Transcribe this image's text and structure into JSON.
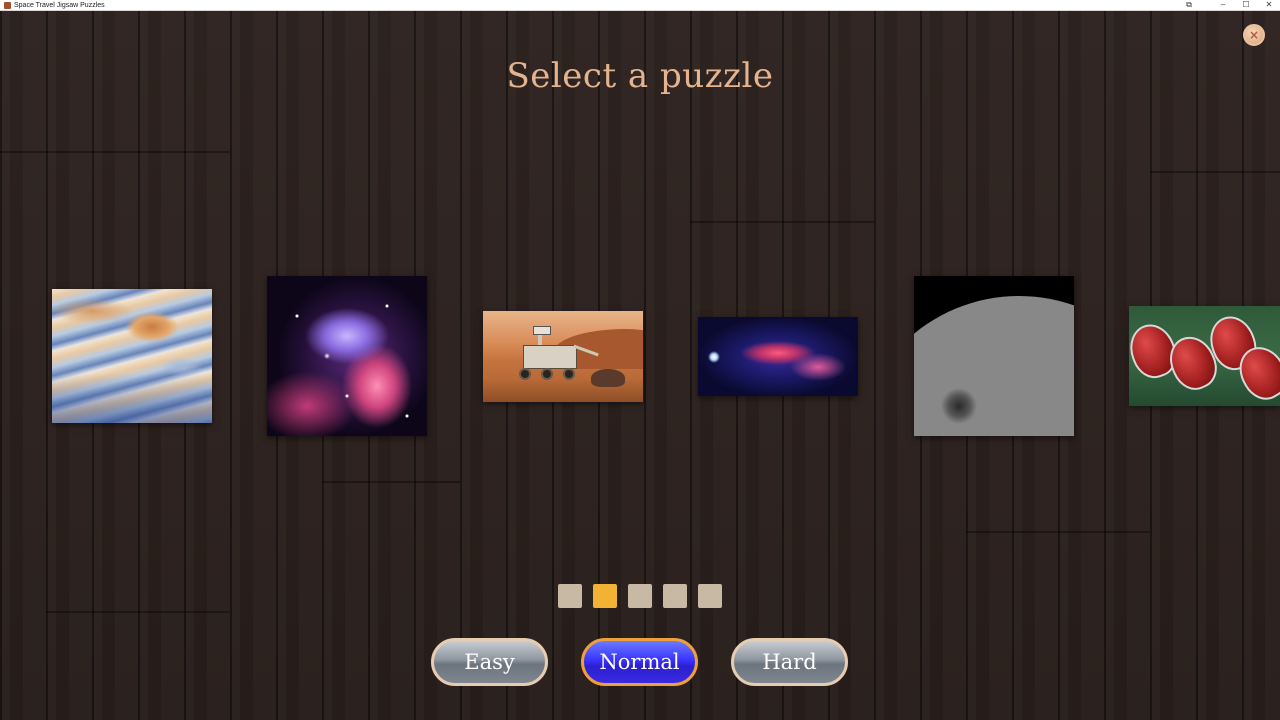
{
  "window": {
    "title": "Space Travel Jigsaw Puzzles",
    "controls": {
      "snap": "⧉",
      "minimize": "–",
      "maximize": "☐",
      "close": "✕"
    }
  },
  "close_button": {
    "glyph": "×"
  },
  "heading": "Select a puzzle",
  "puzzles": [
    {
      "name": "jupiter-great-red-spot"
    },
    {
      "name": "pink-purple-nebula"
    },
    {
      "name": "mars-rover"
    },
    {
      "name": "milky-way-galaxy-center"
    },
    {
      "name": "moon-crater-surface"
    },
    {
      "name": "rocket-engine-nozzles"
    }
  ],
  "pagination": {
    "pages": 5,
    "current_page": 2
  },
  "difficulty": {
    "options": [
      "Easy",
      "Normal",
      "Hard"
    ],
    "selected": "Normal"
  },
  "colors": {
    "heading": "#e3b48f",
    "active_page_dot": "#f2b335",
    "inactive_page_dot": "#c8b9a5",
    "selected_button": "#3a34ff",
    "selected_button_border": "#f0a03a"
  }
}
